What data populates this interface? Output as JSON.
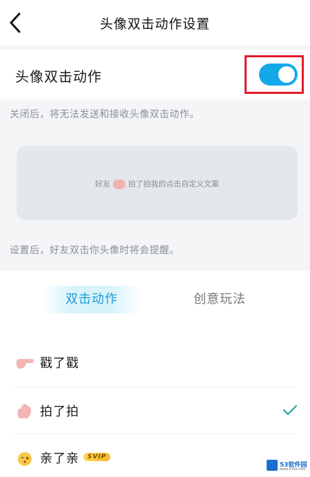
{
  "header": {
    "title": "头像双击动作设置",
    "back_icon": "chevron-left-icon"
  },
  "setting": {
    "label": "头像双击动作",
    "enabled": true,
    "toggle_color": "#14a8e8"
  },
  "hints": {
    "disable_note": "关闭后，将无法发送和接收头像双击动作。",
    "remind_note": "设置后，好友双击你头像时将会提醒。"
  },
  "preview": {
    "prefix": "好友",
    "suffix": "拍了拍我的点击自定义文案"
  },
  "tabs": [
    {
      "label": "双击动作",
      "active": true
    },
    {
      "label": "创意玩法",
      "active": false
    }
  ],
  "actions": [
    {
      "label": "戳了戳",
      "icon": "poke-finger-icon",
      "selected": false
    },
    {
      "label": "拍了拍",
      "icon": "pat-hand-icon",
      "selected": true
    },
    {
      "label": "亲了亲",
      "icon": "kiss-emoji-icon",
      "badge": "SVIP",
      "selected": false
    }
  ],
  "watermark": {
    "text": "53软件园",
    "sub": "www.53xz.com"
  }
}
